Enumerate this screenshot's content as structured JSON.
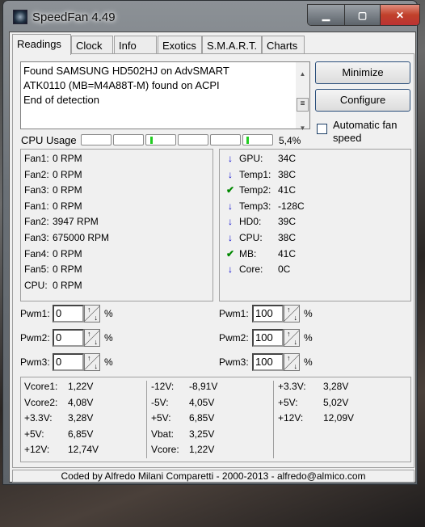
{
  "window": {
    "title": "SpeedFan 4.49",
    "controls": [
      "minimize",
      "maximize",
      "close"
    ]
  },
  "tabs": [
    "Readings",
    "Clock",
    "Info",
    "Exotics",
    "S.M.A.R.T.",
    "Charts"
  ],
  "log": [
    "Found SAMSUNG HD502HJ on AdvSMART",
    "ATK0110 (MB=M4A88T-M) found on ACPI",
    "End of detection"
  ],
  "buttons": {
    "minimize": "Minimize",
    "configure": "Configure"
  },
  "auto_fan": {
    "label": "Automatic fan speed",
    "checked": false
  },
  "cpu_usage": {
    "label": "CPU Usage",
    "value": "5,4%",
    "cores_percent": [
      0,
      0,
      5,
      0,
      0,
      3
    ]
  },
  "fans": [
    {
      "label": "Fan1:",
      "value": "0 RPM"
    },
    {
      "label": "Fan2:",
      "value": "0 RPM"
    },
    {
      "label": "Fan3:",
      "value": "0 RPM"
    },
    {
      "label": "Fan1:",
      "value": "0 RPM"
    },
    {
      "label": "Fan2:",
      "value": "3947 RPM"
    },
    {
      "label": "Fan3:",
      "value": "675000 RPM"
    },
    {
      "label": "Fan4:",
      "value": "0 RPM"
    },
    {
      "label": "Fan5:",
      "value": "0 RPM"
    },
    {
      "label": "CPU:",
      "value": "0 RPM"
    }
  ],
  "temps": [
    {
      "label": "GPU:",
      "value": "34C",
      "icon": "arrow-down"
    },
    {
      "label": "Temp1:",
      "value": "38C",
      "icon": "arrow-down"
    },
    {
      "label": "Temp2:",
      "value": "41C",
      "icon": "check"
    },
    {
      "label": "Temp3:",
      "value": "-128C",
      "icon": "arrow-down"
    },
    {
      "label": "HD0:",
      "value": "39C",
      "icon": "arrow-down"
    },
    {
      "label": "CPU:",
      "value": "38C",
      "icon": "arrow-down"
    },
    {
      "label": "MB:",
      "value": "41C",
      "icon": "check"
    },
    {
      "label": "Core:",
      "value": "0C",
      "icon": "arrow-down"
    }
  ],
  "pwm_left": [
    {
      "label": "Pwm1:",
      "value": "0"
    },
    {
      "label": "Pwm2:",
      "value": "0"
    },
    {
      "label": "Pwm3:",
      "value": "0"
    }
  ],
  "pwm_right": [
    {
      "label": "Pwm1:",
      "value": "100"
    },
    {
      "label": "Pwm2:",
      "value": "100"
    },
    {
      "label": "Pwm3:",
      "value": "100"
    }
  ],
  "pwm_unit": "%",
  "voltages": [
    [
      {
        "label": "Vcore1:",
        "value": "1,22V"
      },
      {
        "label": "Vcore2:",
        "value": "4,08V"
      },
      {
        "label": "+3.3V:",
        "value": "3,28V"
      },
      {
        "label": "+5V:",
        "value": "6,85V"
      },
      {
        "label": "+12V:",
        "value": "12,74V"
      }
    ],
    [
      {
        "label": "-12V:",
        "value": "-8,91V"
      },
      {
        "label": "-5V:",
        "value": "4,05V"
      },
      {
        "label": "+5V:",
        "value": "6,85V"
      },
      {
        "label": "Vbat:",
        "value": "3,25V"
      },
      {
        "label": "Vcore:",
        "value": "1,22V"
      }
    ],
    [
      {
        "label": "+3.3V:",
        "value": "3,28V"
      },
      {
        "label": "+5V:",
        "value": "5,02V"
      },
      {
        "label": "+12V:",
        "value": "12,09V"
      }
    ]
  ],
  "footer": "Coded by Alfredo Milani Comparetti - 2000-2013 - alfredo@almico.com"
}
